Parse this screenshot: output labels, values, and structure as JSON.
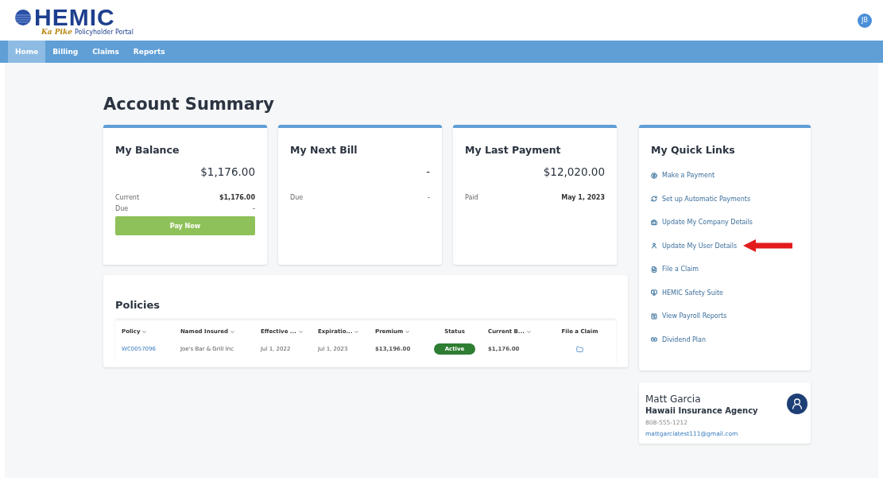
{
  "header": {
    "logo": "HEMIC",
    "tagline_script": "Ka Pike",
    "tagline": "Policyholder Portal",
    "user_initials": "JB"
  },
  "nav": [
    {
      "label": "Home",
      "selected": true
    },
    {
      "label": "Billing",
      "selected": false
    },
    {
      "label": "Claims",
      "selected": false
    },
    {
      "label": "Reports",
      "selected": false
    }
  ],
  "title": "Account Summary",
  "cards": [
    {
      "title": "My Balance",
      "amount": "$1,176.00",
      "rows": [
        {
          "label": "Current",
          "value": "$1,176.00",
          "bold": true
        },
        {
          "label": "Due",
          "value": "-",
          "bold": false
        }
      ],
      "button": "Pay Now"
    },
    {
      "title": "My Next Bill",
      "amount": "-",
      "rows": [
        {
          "label": "Due",
          "value": "-",
          "bold": false
        }
      ]
    },
    {
      "title": "My Last Payment",
      "amount": "$12,020.00",
      "rows": [
        {
          "label": "Paid",
          "value": "May 1, 2023",
          "bold": true
        }
      ]
    }
  ],
  "policies": {
    "title": "Policies",
    "columns": [
      {
        "label": "Policy",
        "sortable": true
      },
      {
        "label": "Named Insured",
        "sortable": true
      },
      {
        "label": "Effective ...",
        "sortable": true
      },
      {
        "label": "Expiratio...",
        "sortable": true
      },
      {
        "label": "Premium",
        "sortable": true
      },
      {
        "label": "Status",
        "sortable": false
      },
      {
        "label": "Current B...",
        "sortable": true
      },
      {
        "label": "File a Claim",
        "sortable": false
      }
    ],
    "rows": [
      {
        "policy": "WC0057096",
        "named_insured": "Joe's Bar & Grill Inc",
        "effective": "Jul 1, 2022",
        "expiration": "Jul 1, 2023",
        "premium": "$13,196.00",
        "status": "Active",
        "current_balance": "$1,176.00"
      }
    ]
  },
  "quick_links": {
    "title": "My Quick Links",
    "items": [
      {
        "kind": "dollar",
        "label": "Make a Payment"
      },
      {
        "kind": "refresh",
        "label": "Set up Automatic Payments"
      },
      {
        "kind": "company",
        "label": "Update My Company Details"
      },
      {
        "kind": "user",
        "label": "Update My User Details",
        "highlighted": true
      },
      {
        "kind": "file",
        "label": "File a Claim"
      },
      {
        "kind": "monitor",
        "label": "HEMIC Safety Suite"
      },
      {
        "kind": "report",
        "label": "View Payroll Reports"
      },
      {
        "kind": "money",
        "label": "Dividend Plan"
      }
    ]
  },
  "contact": {
    "name": "Matt Garcia",
    "agency": "Hawaii Insurance Agency",
    "phone": "808-555-1212",
    "email": "mattgarciatest111@gmail.com"
  }
}
